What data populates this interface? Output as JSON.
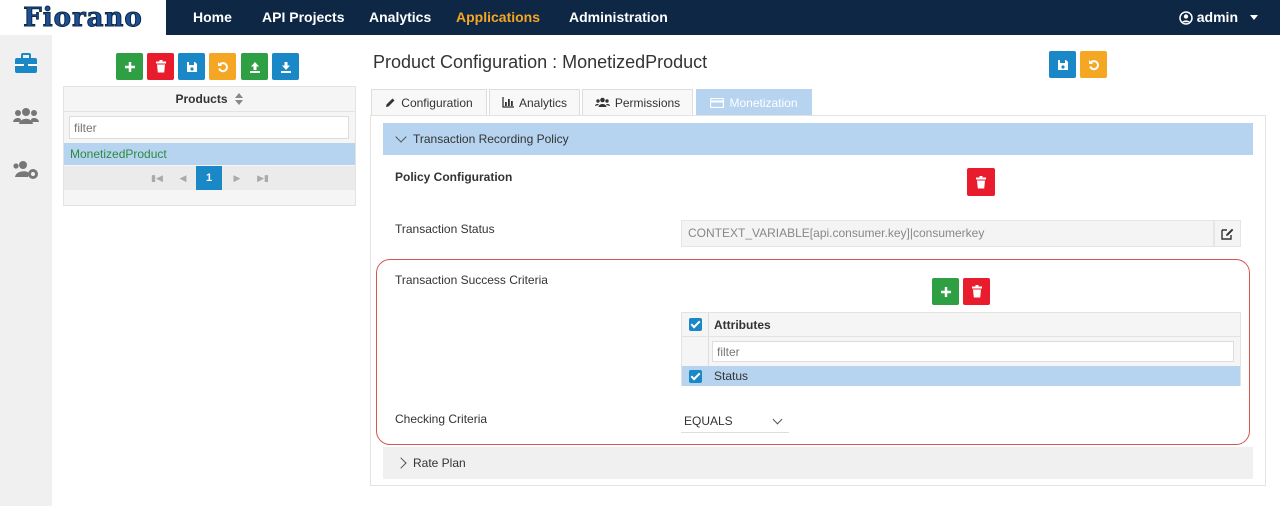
{
  "brand": {
    "logo_text": "Fiorano"
  },
  "nav": {
    "items": [
      {
        "label": "Home"
      },
      {
        "label": "API Projects"
      },
      {
        "label": "Analytics"
      },
      {
        "label": "Applications"
      },
      {
        "label": "Administration"
      }
    ],
    "active": "Applications",
    "user": "admin"
  },
  "sidebar": {
    "icons": [
      "briefcase-icon",
      "users-icon",
      "users-cog-icon"
    ]
  },
  "products": {
    "header": "Products",
    "filter_placeholder": "filter",
    "items": [
      {
        "label": "MonetizedProduct"
      }
    ],
    "page": "1"
  },
  "main": {
    "title": "Product Configuration : MonetizedProduct",
    "tabs": [
      {
        "label": "Configuration",
        "icon": "pencil-icon"
      },
      {
        "label": "Analytics",
        "icon": "bar-chart-icon"
      },
      {
        "label": "Permissions",
        "icon": "users-icon"
      },
      {
        "label": "Monetization",
        "icon": "credit-card-icon"
      }
    ],
    "active_tab": "Monetization",
    "sections": {
      "transaction_policy": "Transaction Recording Policy",
      "rate_plan": "Rate Plan"
    },
    "policy_configuration": "Policy Configuration",
    "transaction_status": {
      "label": "Transaction Status",
      "value": "CONTEXT_VARIABLE[api.consumer.key]|consumerkey"
    },
    "success_criteria": {
      "label": "Transaction Success Criteria",
      "table_header": "Attributes",
      "filter_placeholder": "filter",
      "rows": [
        {
          "label": "Status"
        }
      ]
    },
    "checking_criteria": {
      "label": "Checking Criteria",
      "value": "EQUALS"
    }
  },
  "colors": {
    "nav_bg": "#0d2745",
    "accent": "#f5a623",
    "primary": "#1a87c7",
    "success": "#2ea043",
    "danger": "#e81c2c",
    "selection": "#b6d3f0",
    "highlight_border": "#d9534f"
  }
}
